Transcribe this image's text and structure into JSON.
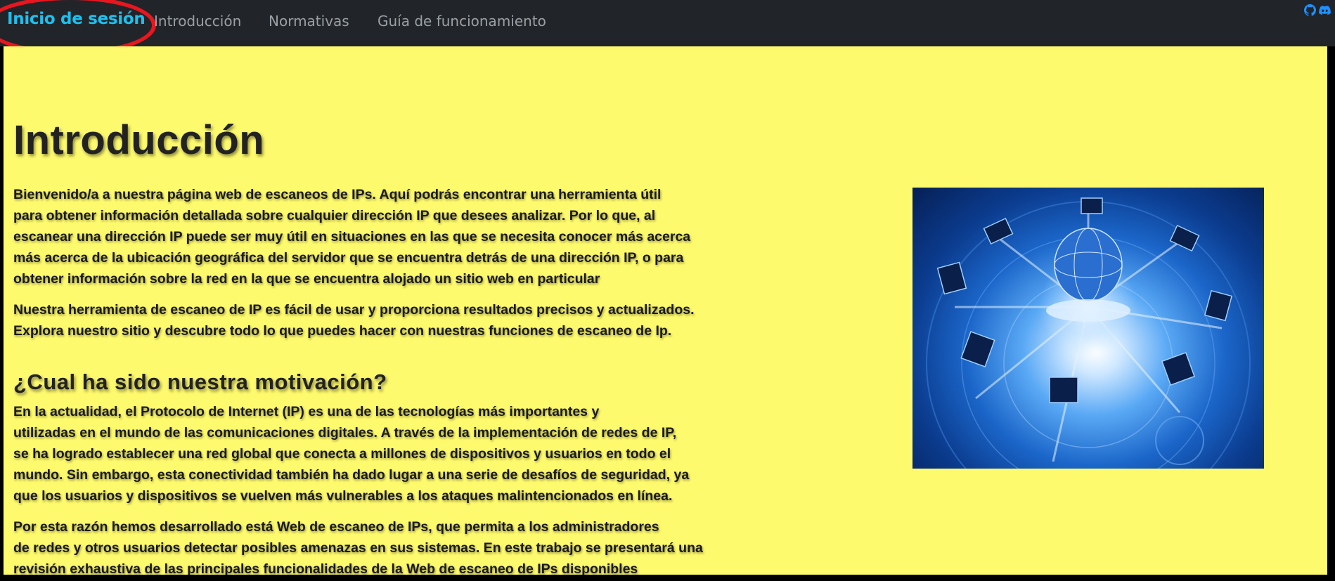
{
  "nav": {
    "brand": "Inicio de sesión",
    "links": [
      "Introducción",
      "Normativas",
      "Guía de funcionamiento"
    ],
    "icons": [
      "github-icon",
      "discord-icon"
    ]
  },
  "main": {
    "title": "Introducción",
    "intro_paragraph_1": [
      "Bienvenido/a a nuestra página web de escaneos de IPs. Aquí podrás encontrar una herramienta útil",
      "para obtener información detallada sobre cualquier dirección IP que desees analizar. Por lo que, al",
      "escanear una dirección IP puede ser muy útil en situaciones en las que se necesita conocer más acerca",
      "más acerca de la ubicación geográfica del servidor que se encuentra detrás de una dirección IP, o para",
      "obtener información sobre la red en la que se encuentra alojado un sitio web en particular"
    ],
    "intro_paragraph_2": [
      "Nuestra herramienta de escaneo de IP es fácil de usar y proporciona resultados precisos y actualizados.",
      "Explora nuestro sitio y descubre todo lo que puedes hacer con nuestras funciones de escaneo de Ip."
    ],
    "motivation_heading": "¿Cual ha sido nuestra motivación?",
    "motivation_paragraph_1": [
      "En la actualidad, el Protocolo de Internet (IP) es una de las tecnologías más importantes y",
      "utilizadas en el mundo de las comunicaciones digitales. A través de la implementación de redes de IP,",
      "se ha logrado establecer una red global que conecta a millones de dispositivos y usuarios en todo el",
      "mundo. Sin embargo, esta conectividad también ha dado lugar a una serie de desafíos de seguridad, ya",
      "que los usuarios y dispositivos se vuelven más vulnerables a los ataques malintencionados en línea."
    ],
    "motivation_paragraph_2": [
      "Por esta razón hemos desarrollado está Web de escaneo de IPs, que permita a los administradores",
      "de redes y otros usuarios detectar posibles amenazas en sus sistemas. En este trabajo se presentará una",
      "revisión exhaustiva de las principales funcionalidades de la Web de escaneo de IPs disponibles"
    ]
  },
  "colors": {
    "navbar_bg": "#212529",
    "brand": "#1ec0ee",
    "nav_link": "#9aa0a6",
    "content_bg": "#fefa6d",
    "highlight_ring": "#e8161f",
    "text": "#1a1a1a"
  }
}
